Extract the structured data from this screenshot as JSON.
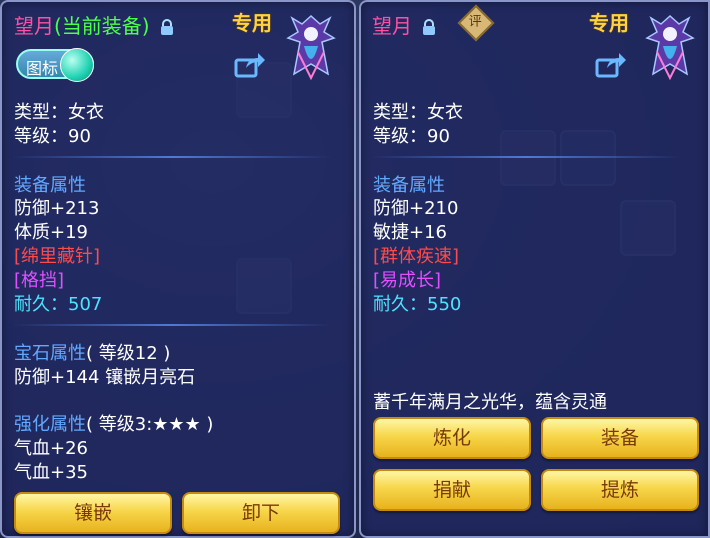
{
  "left": {
    "name": "望月",
    "current_tag": "(当前装备)",
    "exclusive": "专用",
    "toggle_label": "图标",
    "type": "类型：女衣",
    "level": "等级：90",
    "equip_attr_title": "装备属性",
    "attrs": [
      "防御+213",
      "体质+19"
    ],
    "special_red": "[绵里藏针]",
    "special_purple": "[格挡]",
    "durability": "耐久：507",
    "gem_title": "宝石属性",
    "gem_level": "( 等级12 )",
    "gem_line": "防御+144 镶嵌月亮石",
    "enhance_title": "强化属性",
    "enhance_level": "( 等级3:★★★ )",
    "enhance_lines": [
      "气血+26",
      "气血+35"
    ],
    "buttons": [
      "镶嵌",
      "卸下"
    ]
  },
  "right": {
    "name": "望月",
    "badge": "评",
    "exclusive": "专用",
    "type": "类型：女衣",
    "level": "等级：90",
    "equip_attr_title": "装备属性",
    "attrs": [
      "防御+210",
      "敏捷+16"
    ],
    "special_red": "[群体疾速]",
    "special_purple": "[易成长]",
    "durability": "耐久：550",
    "description": "蓄千年满月之光华，蕴含灵通",
    "buttons": [
      "炼化",
      "装备",
      "捐献",
      "提炼"
    ]
  },
  "colors": {
    "name": "#ff4fa6",
    "current": "#4cff4c",
    "section": "#62a8ff",
    "special_red": "#ff4a4a",
    "special_purple": "#e050ff",
    "durability": "#4de3ff",
    "button": "#f7d64a"
  },
  "icons": [
    "lock-icon",
    "share-icon",
    "character-portrait-icon",
    "down-arrow-icon",
    "rating-badge-icon"
  ]
}
